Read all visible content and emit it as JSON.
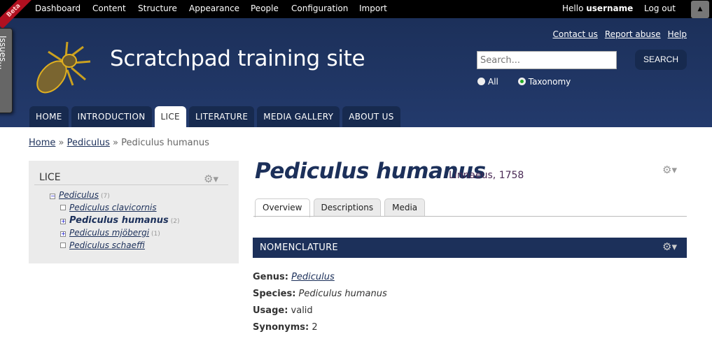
{
  "toolbar": {
    "home_icon": "home-icon",
    "items": [
      "Dashboard",
      "Content",
      "Structure",
      "Appearance",
      "People",
      "Configuration",
      "Import"
    ],
    "hello": "Hello",
    "username": "username",
    "logout": "Log out"
  },
  "ribbon": "Beta",
  "issues_tab": "Issues...",
  "site": {
    "name": "Scratchpad training site",
    "links": [
      "Contact us",
      "Report abuse",
      "Help"
    ],
    "search_placeholder": "Search...",
    "search_button": "SEARCH",
    "radio_all": "All",
    "radio_taxonomy": "Taxonomy",
    "radio_selected": "Taxonomy"
  },
  "nav": {
    "items": [
      "HOME",
      "INTRODUCTION",
      "LICE",
      "LITERATURE",
      "MEDIA GALLERY",
      "ABOUT US"
    ],
    "active": "LICE"
  },
  "breadcrumb": {
    "home": "Home",
    "sep": "»",
    "parent": "Pediculus",
    "current": "Pediculus humanus"
  },
  "sidebar": {
    "title": "LICE",
    "tree": [
      {
        "label": "Pediculus",
        "count": "(7)",
        "toggle": "−"
      },
      {
        "label": "Pediculus clavicornis",
        "count": "",
        "toggle": ""
      },
      {
        "label": "Pediculus humanus",
        "count": "(2)",
        "toggle": "+",
        "bold": true
      },
      {
        "label": "Pediculus mjöbergi",
        "count": "(1)",
        "toggle": "+"
      },
      {
        "label": "Pediculus schaeffi",
        "count": "",
        "toggle": ""
      }
    ]
  },
  "main": {
    "title": "Pediculus humanus",
    "author": "Linnaeus, 1758",
    "tabs": [
      "Overview",
      "Descriptions",
      "Media"
    ],
    "active_tab": "Overview",
    "section": "NOMENCLATURE",
    "fields": [
      {
        "label": "Genus:",
        "value": "Pediculus"
      },
      {
        "label": "Species:",
        "value": "Pediculus humanus"
      },
      {
        "label": "Usage:",
        "value": "valid"
      },
      {
        "label": "Synonyms:",
        "value": "2"
      }
    ]
  }
}
